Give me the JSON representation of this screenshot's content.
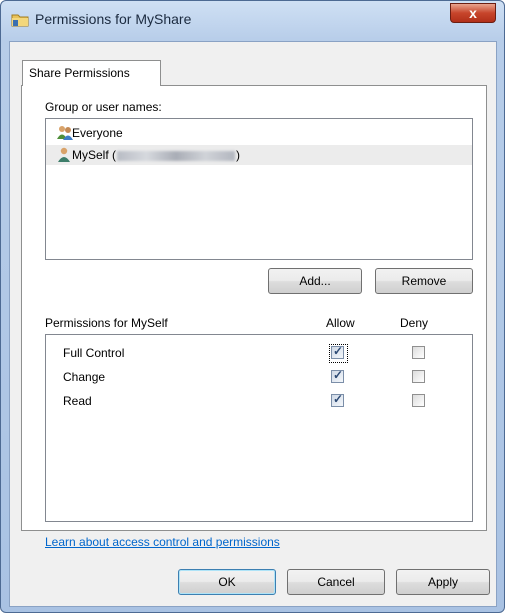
{
  "window": {
    "title": "Permissions for MyShare",
    "close_glyph": "x"
  },
  "tabs": [
    {
      "label": "Share Permissions"
    }
  ],
  "groups": {
    "label": "Group or user names:",
    "items": [
      {
        "name": "Everyone",
        "icon": "group-users-icon"
      },
      {
        "name_prefix": "MySelf (",
        "name_suffix": ")",
        "icon": "single-user-icon",
        "selected": true
      }
    ]
  },
  "buttons": {
    "add": "Add...",
    "remove": "Remove",
    "ok": "OK",
    "cancel": "Cancel",
    "apply": "Apply"
  },
  "permissions": {
    "label": "Permissions for MySelf",
    "col_allow": "Allow",
    "col_deny": "Deny",
    "rows": [
      {
        "name": "Full Control",
        "allow": true,
        "deny": false
      },
      {
        "name": "Change",
        "allow": true,
        "deny": false
      },
      {
        "name": "Read",
        "allow": true,
        "deny": false
      }
    ]
  },
  "link": "Learn about access control and permissions"
}
